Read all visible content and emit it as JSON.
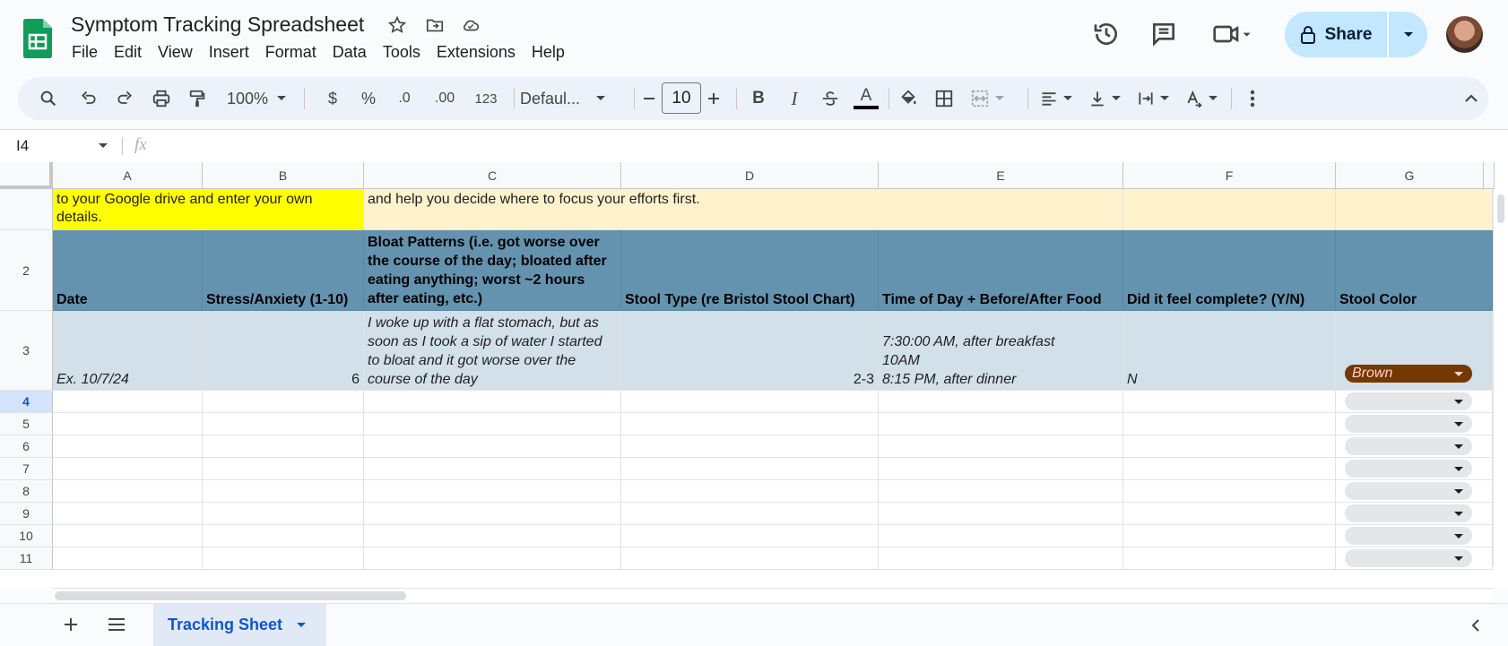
{
  "app": {
    "title": "Symptom Tracking Spreadsheet",
    "menu": [
      "File",
      "Edit",
      "View",
      "Insert",
      "Format",
      "Data",
      "Tools",
      "Extensions",
      "Help"
    ],
    "share_label": "Share",
    "colors": {
      "accent": "#c2e7ff",
      "header_row": "#6493af",
      "example_row": "#d2e0ea",
      "note_row": "#fff2cc",
      "highlight": "#ffff00",
      "chip_brown": "#753800"
    }
  },
  "toolbar": {
    "zoom": "100%",
    "currency": "$",
    "percent": "%",
    "dec_decrease": ".0",
    "dec_increase": ".00",
    "number_format": "123",
    "font": "Defaul...",
    "font_size": "10",
    "bold": "B",
    "italic": "I",
    "text_color": "A"
  },
  "formula_bar": {
    "cell_ref": "I4",
    "fx": "fx",
    "value": ""
  },
  "columns": [
    "A",
    "B",
    "C",
    "D",
    "E",
    "F",
    "G"
  ],
  "rows": {
    "row1": {
      "a": "to your Google drive and enter your own details.",
      "c": "and help you decide where to focus your efforts first."
    },
    "row2": {
      "num": "2",
      "date": "Date",
      "stress": "Stress/Anxiety (1-10)",
      "bloat": "Bloat Patterns (i.e. got worse over the course of the day; bloated after eating anything; worst ~2 hours after eating, etc.)",
      "stool_type": "Stool Type (re Bristol Stool Chart)",
      "time": "Time of Day + Before/After Food",
      "complete": "Did it feel complete? (Y/N)",
      "color": "Stool Color"
    },
    "row3": {
      "num": "3",
      "date": "Ex. 10/7/24",
      "stress": "6",
      "bloat": "I woke up with a flat stomach, but as soon as I took a sip of water I started to bloat and it got worse over the course of the day",
      "stool_type": "2-3",
      "time_1": "7:30:00 AM, after breakfast",
      "time_2": "10AM",
      "time_3": "8:15 PM, after dinner",
      "complete": "N",
      "color": "Brown"
    },
    "empty_rows": [
      "4",
      "5",
      "6",
      "7",
      "8",
      "9",
      "10",
      "11"
    ]
  },
  "sheet_tab": "Tracking Sheet"
}
